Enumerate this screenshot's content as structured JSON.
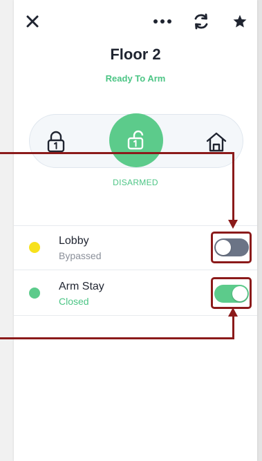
{
  "header": {
    "title": "Floor 2",
    "status": "Ready To Arm",
    "icons": [
      "close-icon",
      "more-icon",
      "refresh-icon",
      "star-icon"
    ]
  },
  "arm_mode": {
    "current": "DISARMED",
    "modes": [
      "locked-icon",
      "unlocked-icon",
      "home-icon"
    ]
  },
  "zones": [
    {
      "name": "Lobby",
      "status": "Bypassed",
      "dot_color": "#f7e11c",
      "status_color": "#8a8f99",
      "bypass_on": false
    },
    {
      "name": "Arm Stay",
      "status": "Closed",
      "dot_color": "#5ccb8b",
      "status_color": "#4cc585",
      "bypass_on": true
    }
  ],
  "colors": {
    "accent": "#5ccb8b",
    "callout": "#8b1a1a",
    "toggle_off": "#6b7486"
  }
}
